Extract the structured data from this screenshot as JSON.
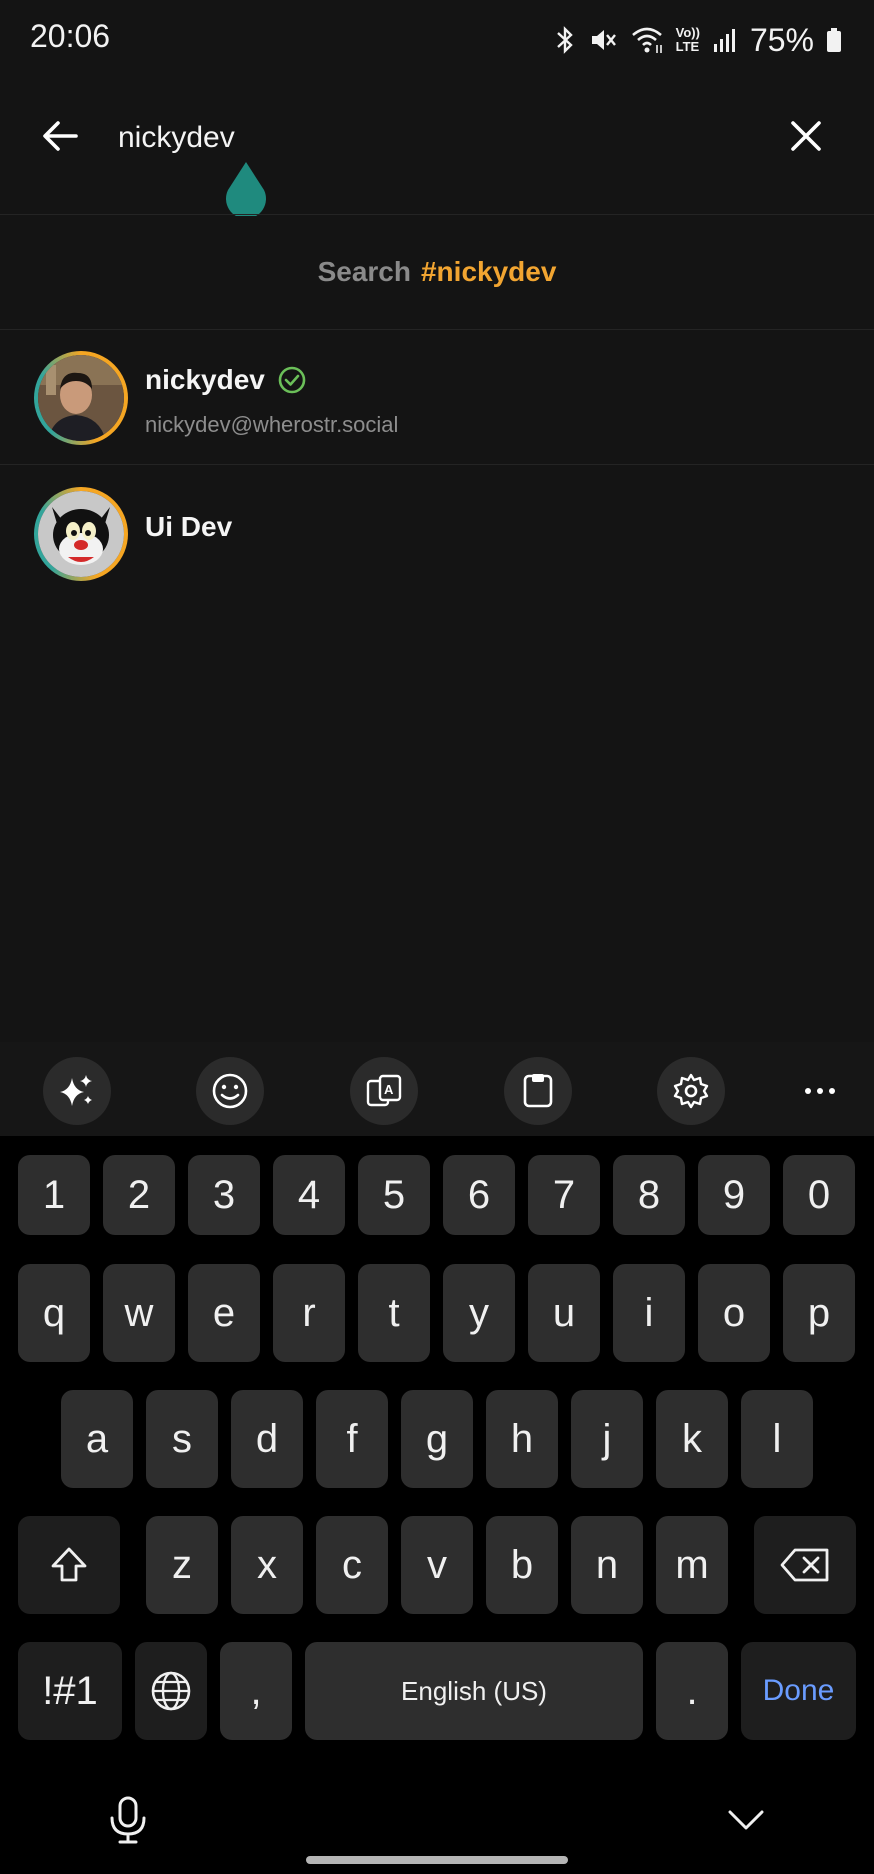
{
  "status_bar": {
    "time": "20:06",
    "battery_percent": "75%",
    "network_label_top": "Vo))",
    "network_label_bottom": "LTE"
  },
  "search": {
    "query": "nickydev",
    "hashtag_prefix": "Search",
    "hashtag_term": "#nickydev"
  },
  "results": [
    {
      "name": "nickydev",
      "verified": true,
      "nip05": "nickydev@wherostr.social"
    },
    {
      "name": "Ui Dev",
      "verified": false,
      "nip05": ""
    }
  ],
  "keyboard": {
    "number_row": [
      "1",
      "2",
      "3",
      "4",
      "5",
      "6",
      "7",
      "8",
      "9",
      "0"
    ],
    "row1": [
      "q",
      "w",
      "e",
      "r",
      "t",
      "y",
      "u",
      "i",
      "o",
      "p"
    ],
    "row2": [
      "a",
      "s",
      "d",
      "f",
      "g",
      "h",
      "j",
      "k",
      "l"
    ],
    "row3": [
      "z",
      "x",
      "c",
      "v",
      "b",
      "n",
      "m"
    ],
    "symbols_label": "!#1",
    "comma": ",",
    "space_label": "English (US)",
    "period": ".",
    "done_label": "Done"
  },
  "colors": {
    "accent_orange": "#f2a531",
    "verified_green": "#6bbf59",
    "teal": "#1f8a7e",
    "done_blue": "#6a9cff"
  }
}
